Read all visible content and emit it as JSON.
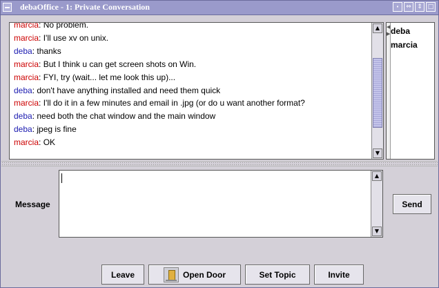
{
  "window": {
    "title": "debaOffice - 1: Private Conversation"
  },
  "title_buttons": [
    "⬝",
    "⇔",
    "⇕",
    "□"
  ],
  "chat": {
    "lines": [
      {
        "user": "marcia",
        "text": "No problem."
      },
      {
        "user": "marcia",
        "text": "I'll use xv on unix."
      },
      {
        "user": "deba",
        "text": "thanks"
      },
      {
        "user": "marcia",
        "text": "But I think u can get screen shots on Win."
      },
      {
        "user": "marcia",
        "text": "FYI, try (wait... let me look this up)..."
      },
      {
        "user": "deba",
        "text": "don't have anything installed and need them quick"
      },
      {
        "user": "marcia",
        "text": "I'll do it in a few minutes and email in .jpg (or do u want another format?"
      },
      {
        "user": "deba",
        "text": "need both the chat window and the main window"
      },
      {
        "user": "deba",
        "text": "jpeg is fine"
      },
      {
        "user": "marcia",
        "text": "OK"
      }
    ],
    "scroll_position": 0.55
  },
  "users": [
    "deba",
    "marcia"
  ],
  "message": {
    "label": "Message",
    "value": ""
  },
  "buttons": {
    "send": "Send",
    "leave": "Leave",
    "open_door": "Open Door",
    "set_topic": "Set Topic",
    "invite": "Invite"
  },
  "colors": {
    "marcia": "#cc0000",
    "deba": "#1a1ab0",
    "title_bar": "#9a9acb"
  },
  "icons": {
    "open_door": "door-icon"
  }
}
